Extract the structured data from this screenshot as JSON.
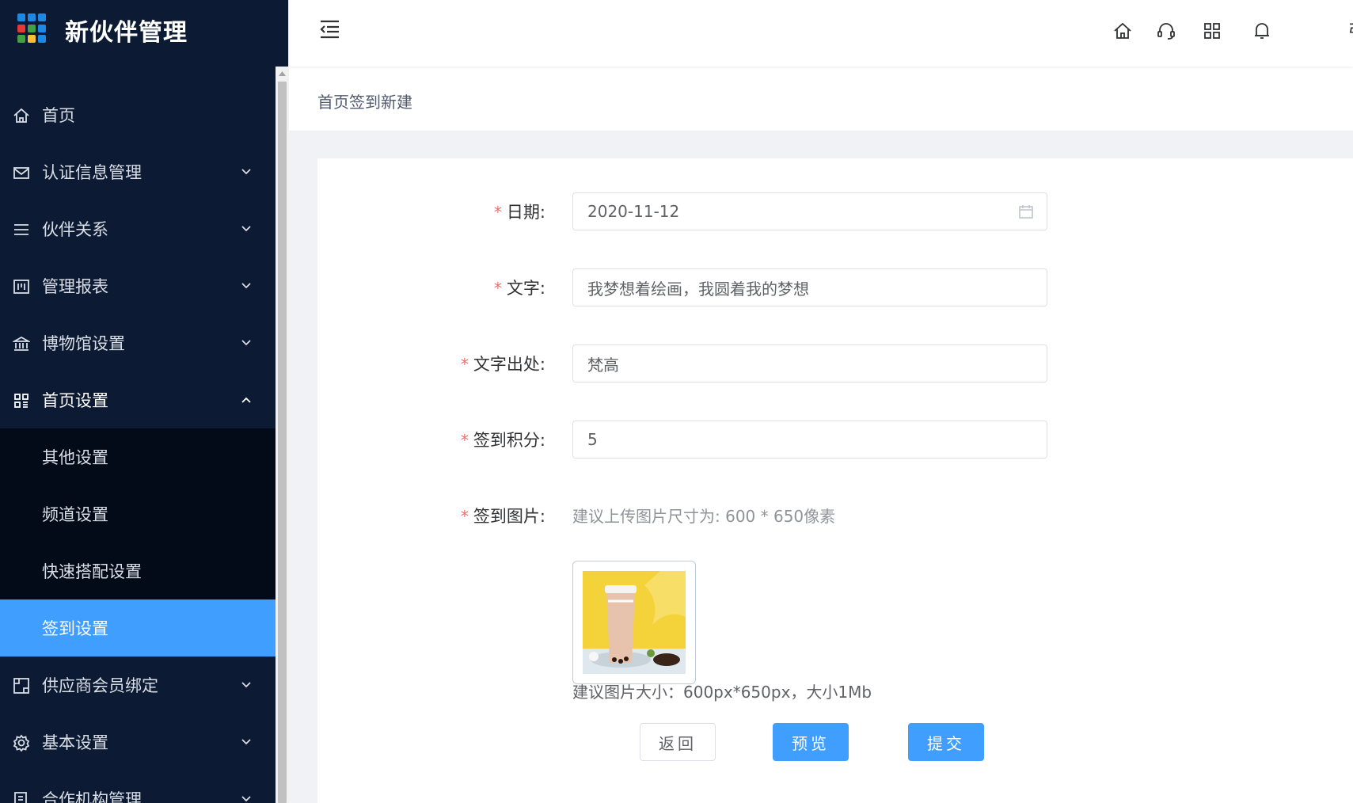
{
  "brand": {
    "title": "新伙伴管理",
    "logo_colors": [
      "#1e88e5",
      "#1e88e5",
      "#1e88e5",
      "#e53935",
      "#43a047",
      "#1e88e5",
      "#43a047",
      "#fbc02d",
      "#1e88e5"
    ]
  },
  "sidebar": {
    "items": [
      {
        "label": "首页",
        "icon": "home-icon"
      },
      {
        "label": "认证信息管理",
        "icon": "mail-icon"
      },
      {
        "label": "伙伴关系",
        "icon": "list-icon"
      },
      {
        "label": "管理报表",
        "icon": "report-icon"
      },
      {
        "label": "博物馆设置",
        "icon": "museum-icon"
      },
      {
        "label": "首页设置",
        "icon": "grid-icon"
      },
      {
        "label": "供应商会员绑定",
        "icon": "bind-icon"
      },
      {
        "label": "基本设置",
        "icon": "gear-icon"
      },
      {
        "label": "合作机构管理",
        "icon": "org-icon"
      }
    ],
    "submenu": [
      {
        "label": "其他设置"
      },
      {
        "label": "频道设置"
      },
      {
        "label": "快速搭配设置"
      },
      {
        "label": "签到设置",
        "active": true
      }
    ]
  },
  "header": {
    "icons": [
      "home-icon",
      "headset-icon",
      "apps-icon",
      "bell-icon"
    ],
    "truncated_text": "弓"
  },
  "breadcrumb": "首页签到新建",
  "form": {
    "date": {
      "label": "日期",
      "value": "2020-11-12"
    },
    "text": {
      "label": "文字",
      "value": "我梦想着绘画，我圆着我的梦想"
    },
    "source": {
      "label": "文字出处",
      "value": "梵高"
    },
    "points": {
      "label": "签到积分",
      "value": "5"
    },
    "image": {
      "label": "签到图片",
      "hint": "建议上传图片尺寸为: 600 * 650像素"
    },
    "colon": ":",
    "required_mark": "*",
    "note": "建议图片大小：600px*650px，大小1Mb"
  },
  "buttons": {
    "back": "返回",
    "preview": "预览",
    "submit": "提交"
  },
  "colors": {
    "sidebar_bg": "#0c1b33",
    "submenu_bg": "#020b17",
    "accent": "#409eff",
    "required": "#f56c6c"
  }
}
